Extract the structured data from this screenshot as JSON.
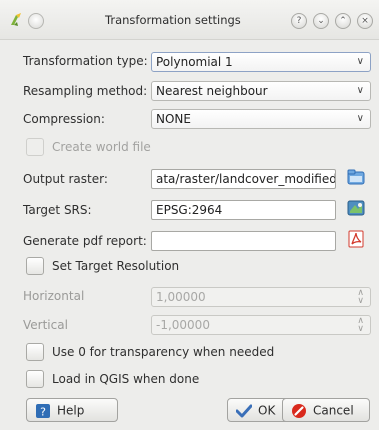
{
  "window": {
    "title": "Transformation settings",
    "title_buttons": [
      "help",
      "minimize",
      "maximize",
      "close"
    ]
  },
  "form": {
    "transformation_type": {
      "label": "Transformation type:",
      "value": "Polynomial 1"
    },
    "resampling_method": {
      "label": "Resampling method:",
      "value": "Nearest neighbour"
    },
    "compression": {
      "label": "Compression:",
      "value": "NONE"
    },
    "create_world_file": {
      "label": "Create world file",
      "checked": false,
      "enabled": false
    },
    "output_raster": {
      "label": "Output raster:",
      "value": "ata/raster/landcover_modified.tif",
      "icon": "folder-open-icon"
    },
    "target_srs": {
      "label": "Target SRS:",
      "value": "EPSG:2964",
      "icon": "projection-icon"
    },
    "pdf_report": {
      "label": "Generate pdf report:",
      "value": "",
      "icon": "pdf-icon"
    },
    "set_target_resolution": {
      "label": "Set Target Resolution",
      "checked": false
    },
    "horizontal": {
      "label": "Horizontal",
      "value": "1,00000"
    },
    "vertical": {
      "label": "Vertical",
      "value": "-1,00000"
    },
    "use_zero_transparency": {
      "label": "Use 0 for transparency when needed",
      "checked": false
    },
    "load_in_qgis": {
      "label": "Load in QGIS when done",
      "checked": false
    }
  },
  "buttons": {
    "help": "Help",
    "ok": "OK",
    "cancel": "Cancel"
  },
  "colors": {
    "window_bg": "#ededeb",
    "combo_border_focus": "#8da2c5",
    "pdf_red": "#d33a2c",
    "cancel_red": "#d9291c",
    "ok_check_blue": "#3a6fb8"
  }
}
